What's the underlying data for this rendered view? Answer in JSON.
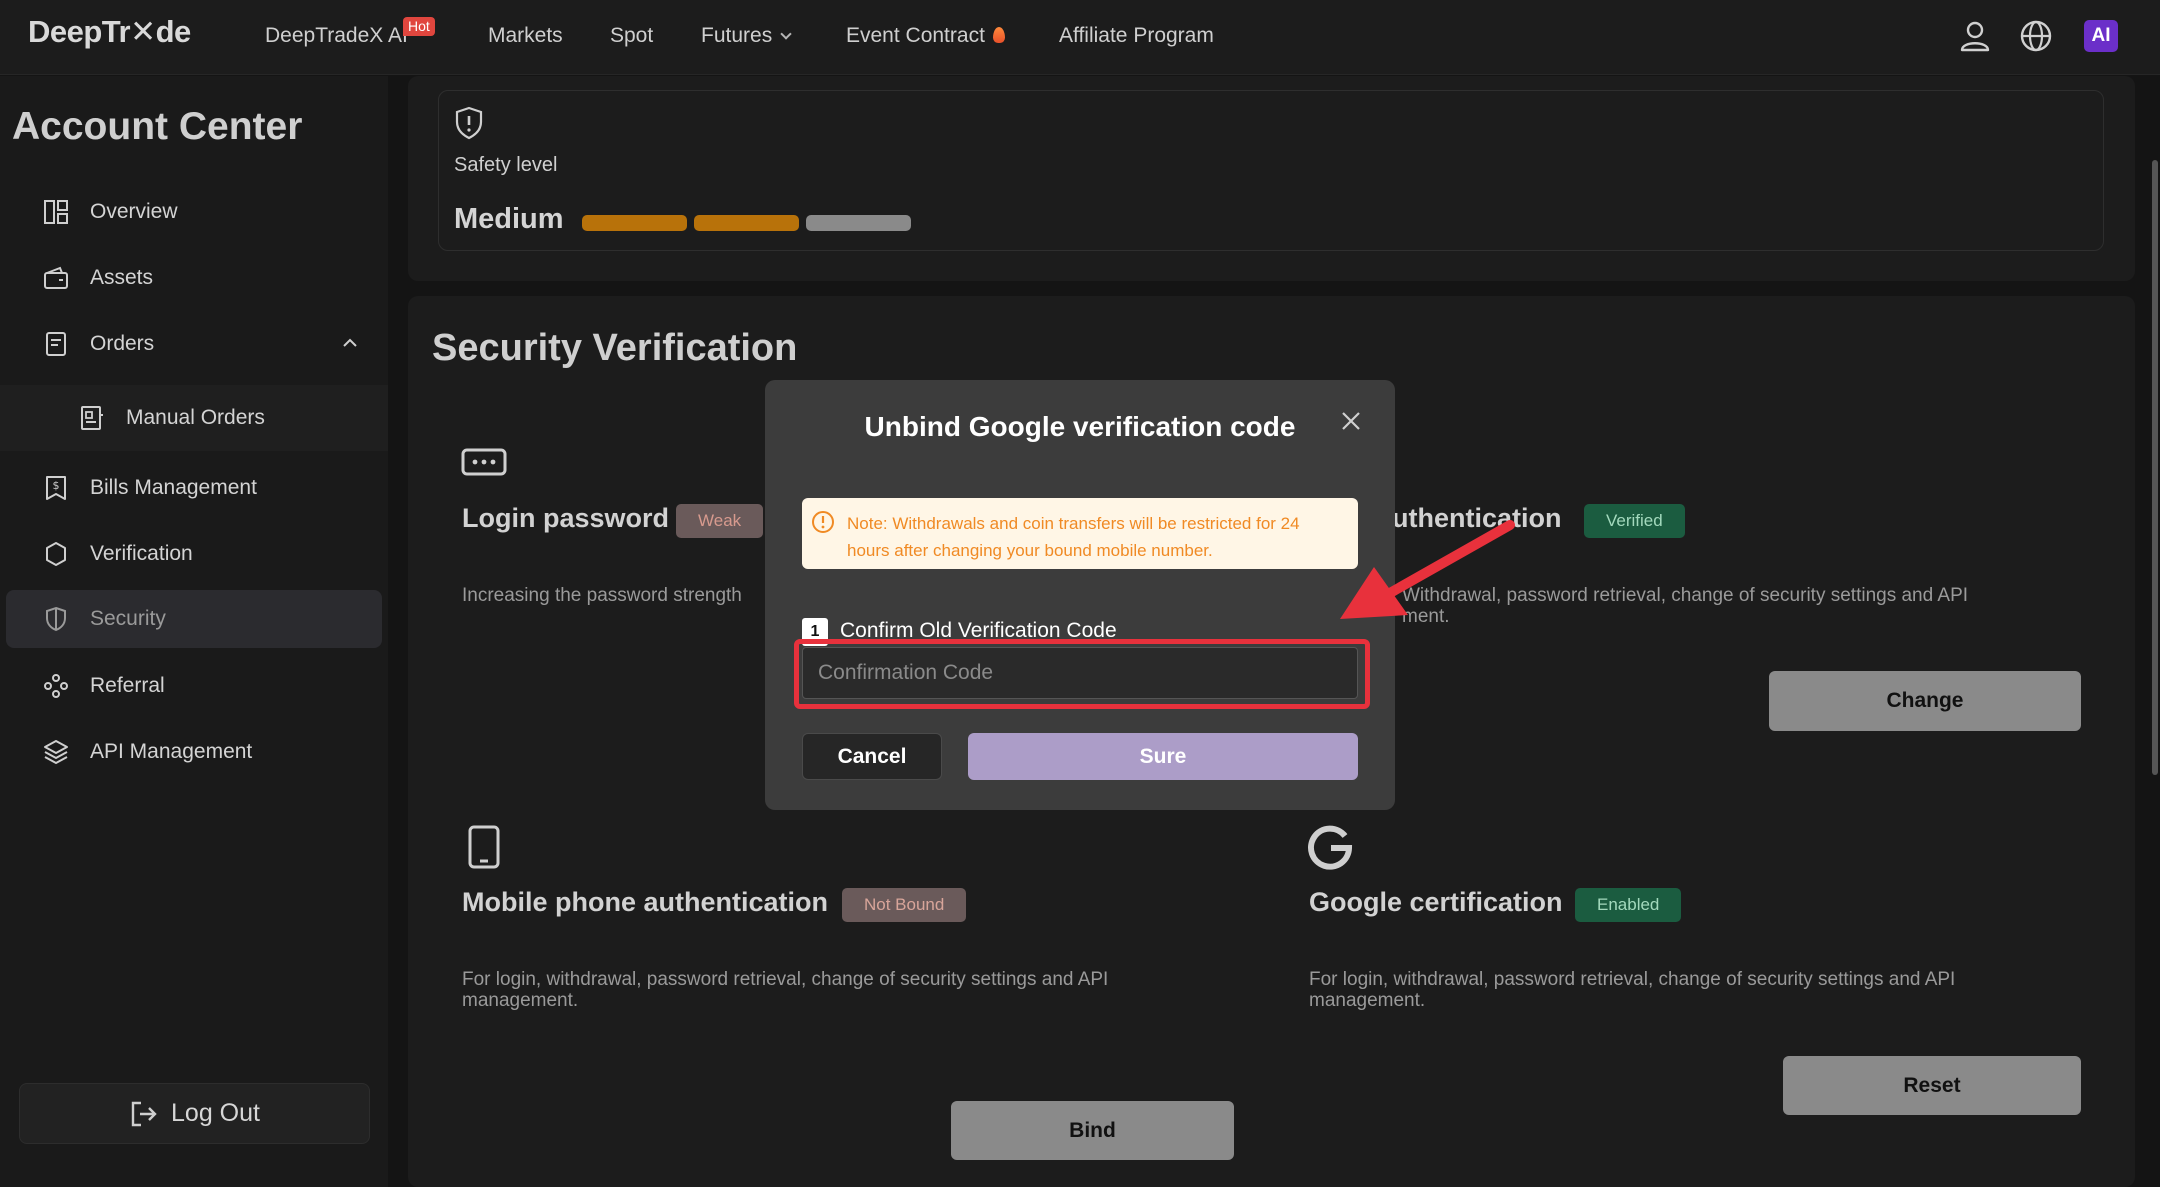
{
  "header": {
    "logo": "DeepTr✕de",
    "nav": {
      "ai": "DeepTradeX AI",
      "hot": "Hot",
      "markets": "Markets",
      "spot": "Spot",
      "futures": "Futures",
      "event": "Event Contract",
      "affiliate": "Affiliate Program"
    },
    "ai_badge": "AI"
  },
  "sidebar": {
    "title": "Account Center",
    "items": {
      "overview": "Overview",
      "assets": "Assets",
      "orders": "Orders",
      "manual_orders": "Manual Orders",
      "bills": "Bills Management",
      "verification": "Verification",
      "security": "Security",
      "referral": "Referral",
      "api": "API Management"
    },
    "logout": "Log Out"
  },
  "safety": {
    "label": "Safety level",
    "level": "Medium",
    "filled_segments": 2,
    "total_segments": 3
  },
  "security": {
    "title": "Security Verification",
    "login": {
      "title": "Login password",
      "badge": "Weak",
      "desc": "Increasing the password strength"
    },
    "email": {
      "title_partial": "uthentication",
      "badge": "Verified",
      "desc_line1": "Withdrawal, password retrieval, change of security settings and API",
      "desc_line2": "ment.",
      "button": "Change"
    },
    "mobile": {
      "title": "Mobile phone authentication",
      "badge": "Not Bound",
      "desc_line1": "For login, withdrawal, password retrieval, change of security settings and API",
      "desc_line2": "management.",
      "button": "Bind"
    },
    "google": {
      "title": "Google certification",
      "badge": "Enabled",
      "desc_line1": "For login, withdrawal, password retrieval, change of security settings and API",
      "desc_line2": "management.",
      "button": "Reset"
    }
  },
  "modal": {
    "title": "Unbind Google verification code",
    "note_line1": "Note: Withdrawals and coin transfers will be restricted for 24",
    "note_line2": "hours after changing your bound mobile number.",
    "step_number": "1",
    "step_label": "Confirm Old Verification Code",
    "input_placeholder": "Confirmation Code",
    "input_value": "",
    "cancel": "Cancel",
    "sure": "Sure"
  },
  "colors": {
    "accent_purple": "#ac9dc8",
    "safety_bar_filled": "#b8720a",
    "safety_bar_empty": "#8a8a8a",
    "highlight_red": "#e8313c"
  }
}
